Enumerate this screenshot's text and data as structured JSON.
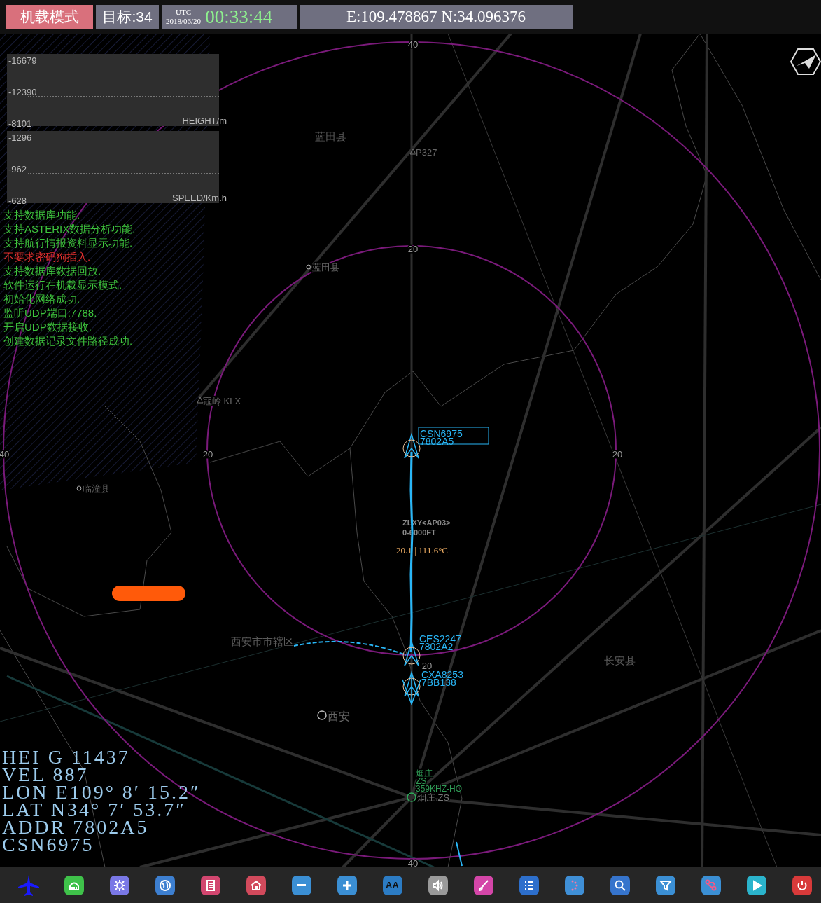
{
  "top_bar": {
    "mode": "机载模式",
    "targets": "目标:34",
    "utc_label": "UTC",
    "date": "2018/06/20",
    "time": "00:33:44",
    "position": "E:109.478867 N:34.096376"
  },
  "height_chart": {
    "ticks": [
      "-16679",
      "-12390",
      "-8101"
    ],
    "unit": "HEIGHT/m"
  },
  "speed_chart": {
    "ticks": [
      "-1296",
      "-962",
      "-628"
    ],
    "unit": "SPEED/Km.h"
  },
  "log": [
    {
      "text": "支持数据库功能.",
      "kind": "info"
    },
    {
      "text": "支持ASTERIX数据分析功能.",
      "kind": "info"
    },
    {
      "text": "支持航行情报资料显示功能.",
      "kind": "info"
    },
    {
      "text": "不要求密码狗插入.",
      "kind": "error"
    },
    {
      "text": "支持数据库数据回放.",
      "kind": "info"
    },
    {
      "text": "软件运行在机载显示模式.",
      "kind": "info"
    },
    {
      "text": "初始化网络成功.",
      "kind": "info"
    },
    {
      "text": "监听UDP端口:7788.",
      "kind": "info"
    },
    {
      "text": "开启UDP数据接收.",
      "kind": "info"
    },
    {
      "text": "创建数据记录文件路径成功.",
      "kind": "info"
    }
  ],
  "range_labels": [
    "40",
    "20",
    "40",
    "20",
    "20",
    "20",
    "40"
  ],
  "places": [
    {
      "name": "蓝田县",
      "kind": "area"
    },
    {
      "name": "P327",
      "kind": "waypoint"
    },
    {
      "name": "蓝田县",
      "kind": "town"
    },
    {
      "name": "寇岭 KLX",
      "kind": "waypoint"
    },
    {
      "name": "临潼县",
      "kind": "town"
    },
    {
      "name": "西安市市辖区",
      "kind": "area"
    },
    {
      "name": "长安县",
      "kind": "area"
    },
    {
      "name": "西安",
      "kind": "city"
    },
    {
      "name": "烟庄 ZS",
      "kind": "navaid"
    }
  ],
  "navaid_tag": [
    "烟庄",
    "ZS",
    "359KHZ-HO"
  ],
  "zone_label": [
    "ZLXY<AP03>",
    "0-6000FT"
  ],
  "track_reading": "20.1 | 111.6°C",
  "tracks": [
    {
      "callsign": "CSN6975",
      "code": "7802A5",
      "selected": true
    },
    {
      "callsign": "CES2247",
      "code": "7802A2",
      "selected": false
    },
    {
      "callsign": "CXA8253",
      "code": "7BB138",
      "selected": false
    }
  ],
  "readout": [
    "HEI G 11437",
    "VEL 887",
    "LON E109° 8′ 15.2″",
    "LAT N34° 7′ 53.7″",
    "ADDR 7802A5",
    "CSN6975"
  ],
  "toolbar": [
    {
      "kind": "plane",
      "color": "#1a1aff"
    },
    {
      "kind": "radar",
      "color": "#3fc24a"
    },
    {
      "kind": "gear",
      "color": "#7a78e6"
    },
    {
      "kind": "globe",
      "color": "#3d7fd0"
    },
    {
      "kind": "notes",
      "color": "#d2466f"
    },
    {
      "kind": "home",
      "color": "#d24a5c"
    },
    {
      "kind": "minus",
      "color": "#3b8fd4"
    },
    {
      "kind": "plus",
      "color": "#3b8fd4"
    },
    {
      "kind": "font",
      "color": "#2c7cc4",
      "label": "AA"
    },
    {
      "kind": "speaker",
      "color": "#9a9a9a"
    },
    {
      "kind": "brush",
      "color": "#d446a8"
    },
    {
      "kind": "list",
      "color": "#2d6fcc"
    },
    {
      "kind": "dots",
      "color": "#3f8fd6"
    },
    {
      "kind": "search",
      "color": "#3674cc"
    },
    {
      "kind": "filter",
      "color": "#3b8fd4"
    },
    {
      "kind": "route",
      "color": "#3b8fd4"
    },
    {
      "kind": "play",
      "color": "#2bb4cc"
    },
    {
      "kind": "power",
      "color": "#d83a3a"
    }
  ]
}
